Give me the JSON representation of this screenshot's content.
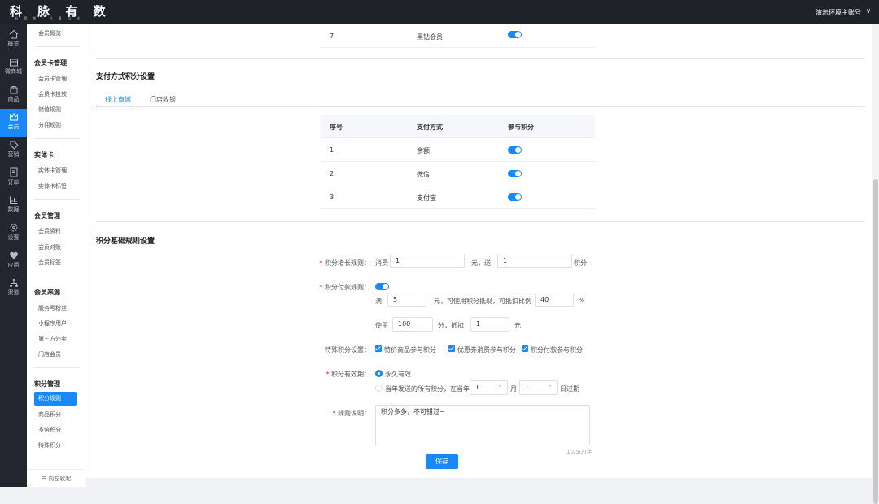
{
  "topbar": {
    "logo": "科 脉 有 数",
    "logo_sub": "新 零 售 · 共 赢 科 技",
    "account": "演示环境主账号",
    "caret": "∨"
  },
  "nav": [
    {
      "label": "概览",
      "icon": "home-icon"
    },
    {
      "label": "微商城",
      "icon": "shop-icon"
    },
    {
      "label": "商品",
      "icon": "bag-icon"
    },
    {
      "label": "会员",
      "icon": "member-icon",
      "active": true
    },
    {
      "label": "营销",
      "icon": "tag-icon"
    },
    {
      "label": "订单",
      "icon": "order-icon"
    },
    {
      "label": "数据",
      "icon": "chart-icon"
    },
    {
      "label": "设置",
      "icon": "gear-icon"
    },
    {
      "label": "应用",
      "icon": "app-icon"
    },
    {
      "label": "渠道",
      "icon": "channel-icon"
    }
  ],
  "subnav": {
    "overview": "会员概览",
    "group1": "会员卡管理",
    "g1": [
      "会员卡管理",
      "会员卡投放",
      "储值规则",
      "分佣规则"
    ],
    "group2": "实体卡",
    "g2": [
      "实体卡管理",
      "实体卡标签"
    ],
    "group3": "会员管理",
    "g3": [
      "会员资料",
      "会员对账",
      "会员标签"
    ],
    "group4": "会员来源",
    "g4": [
      "服务号粉丝",
      "小程序用户",
      "第三方外卖",
      "门店会员"
    ],
    "group5": "积分管理",
    "g5": [
      "积分规则",
      "商品积分",
      "多倍积分",
      "特殊积分"
    ],
    "collapse": "向左收起"
  },
  "top_row": {
    "no": "7",
    "name": "黑钻会员"
  },
  "payment": {
    "title": "支付方式积分设置",
    "tabs": [
      "线上商城",
      "门店收银"
    ],
    "headers": [
      "序号",
      "支付方式",
      "参与积分"
    ],
    "rows": [
      {
        "no": "1",
        "method": "余额"
      },
      {
        "no": "2",
        "method": "微信"
      },
      {
        "no": "3",
        "method": "支付宝"
      }
    ]
  },
  "rules": {
    "title": "积分基础规则设置",
    "growth_label": "积分增长规则：",
    "consume": "消费",
    "consume_val": "1",
    "yuan_give": "元，送",
    "give_val": "1",
    "points": "积分",
    "pay_label": "积分付款规则：",
    "full": "满",
    "full_val": "5",
    "full_text": "元，可使用积分抵现，可抵扣比例",
    "ratio_val": "40",
    "percent": "%",
    "use": "使用",
    "use_val": "100",
    "use_text": "分，抵扣",
    "deduct_val": "1",
    "yuan": "元",
    "special_label": "特殊积分设置：",
    "special": [
      "特价商品参与积分",
      "优惠券消费参与积分",
      "积分付款参与积分"
    ],
    "valid_label": "积分有效期：",
    "valid_forever": "永久有效",
    "valid_year": "当年发送的所有积分，在当年",
    "month_val": "1",
    "month": "月",
    "day_val": "1",
    "day": "日过期",
    "desc_label": "规则说明：",
    "desc_val": "积分多多，不可错过~",
    "counter": "10/500字",
    "save": "保存"
  },
  "accent": "#1989fa"
}
